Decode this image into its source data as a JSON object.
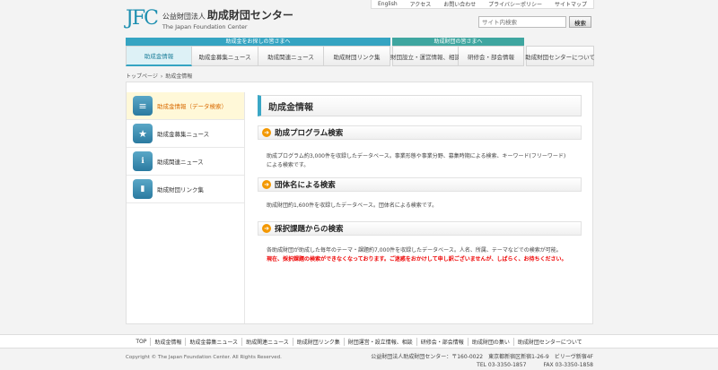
{
  "header": {
    "logo_mark": "JFC",
    "logo_prefix": "公益財団法人",
    "logo_name": "助成財団センター",
    "logo_en": "The Japan Foundation Center",
    "util_links": [
      "English",
      "アクセス",
      "お問い合わせ",
      "プライバシーポリシー",
      "サイトマップ"
    ],
    "search_placeholder": "サイト内検索",
    "search_button": "検索"
  },
  "nav": {
    "group1_label": "助成金をお探しの皆さまへ",
    "group2_label": "助成財団の皆さまへ",
    "items": [
      "助成金情報",
      "助成金募集ニュース",
      "助成関連ニュース",
      "助成財団リンク集",
      "財団設立・運営情報、相談",
      "研修会・部会情報",
      "助成財団センターについて"
    ]
  },
  "breadcrumb": [
    "トップページ",
    "助成金情報"
  ],
  "sidebar": [
    {
      "label": "助成金情報（データ検索）",
      "icon": "database-icon"
    },
    {
      "label": "助成金募集ニュース",
      "icon": "star-icon"
    },
    {
      "label": "助成関連ニュース",
      "icon": "info-icon"
    },
    {
      "label": "助成財団リンク集",
      "icon": "bookmark-icon"
    }
  ],
  "main": {
    "title": "助成金情報",
    "sections": [
      {
        "heading": "助成プログラム検索",
        "text": "助成プログラム約3,000件を収録したデータベース。事業形態や事業分野、募集時期による検索、キーワード(フリーワード) による検索です。"
      },
      {
        "heading": "団体名による検索",
        "text": "助成財団約1,600件を収録したデータベース。団体名による検索です。"
      },
      {
        "heading": "採択課題からの検索",
        "text": "各助成財団が助成した毎年のテーマ・課題約7,000件を収録したデータベース。人名、所属、テーマなどでの検索が可能。",
        "warning": "現在、採択課題の検索ができなくなっております。ご迷惑をおかけして申し訳ございませんが、しばらく、お待ちください。"
      }
    ]
  },
  "footer": {
    "links": [
      "TOP",
      "助成金情報",
      "助成金募集ニュース",
      "助成関連ニュース",
      "助成財団リンク集",
      "財団運営・設立情報、相談",
      "研修会・部会情報",
      "助成財団の集い",
      "助成財団センターについて"
    ],
    "copyright": "Copyright © The Japan Foundation Center. All Rights Reserved.",
    "address": "公益財団法人助成財団センター：〒160-0022　東京都新宿区新宿1-26-9　ビリーヴ新宿4F",
    "tel": "TEL 03-3350-1857",
    "fax": "FAX 03-3350-1858"
  }
}
